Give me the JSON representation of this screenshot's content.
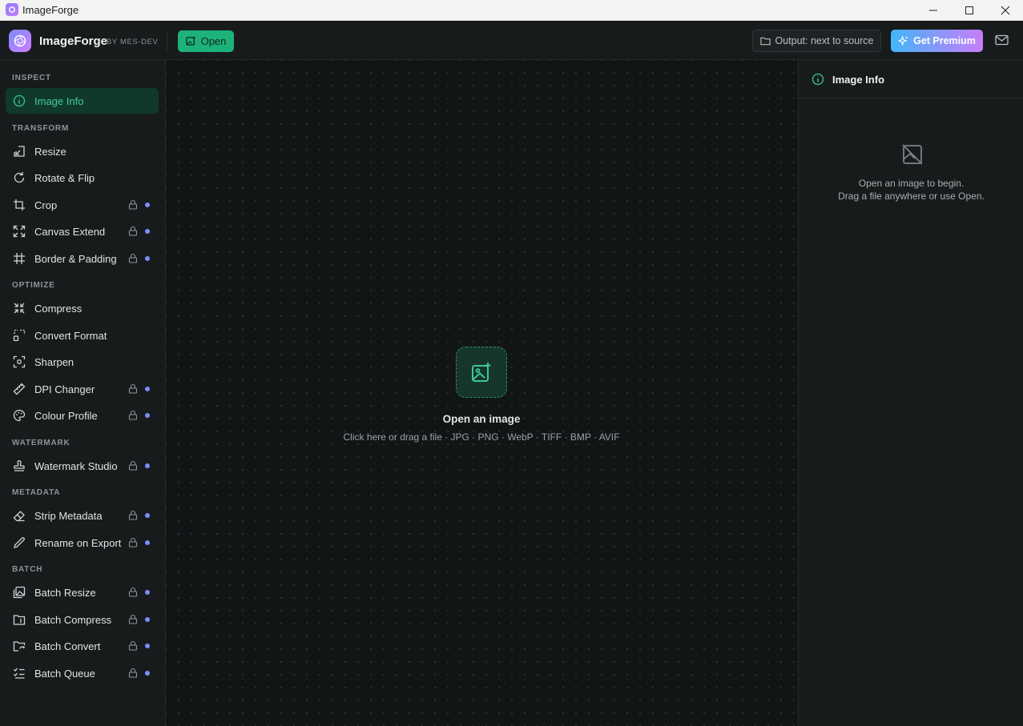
{
  "window": {
    "title": "ImageForge"
  },
  "header": {
    "brand": "ImageForge",
    "by": "BY MES-DEV",
    "open_label": "Open",
    "output_label": "Output: next to source",
    "premium_label": "Get Premium"
  },
  "colors": {
    "accent": "#1db27a",
    "premium_start": "#43b5f7",
    "premium_end": "#c77dfa",
    "locked_dot": "#7f8dfb"
  },
  "sidebar": {
    "sections": [
      {
        "title": "INSPECT"
      },
      {
        "title": "TRANSFORM"
      },
      {
        "title": "OPTIMIZE"
      },
      {
        "title": "WATERMARK"
      },
      {
        "title": "METADATA"
      },
      {
        "title": "BATCH"
      }
    ],
    "items": [
      {
        "label": "Image Info",
        "icon": "info-icon",
        "active": true,
        "locked": false
      },
      {
        "label": "Resize",
        "icon": "resize-icon",
        "locked": false
      },
      {
        "label": "Rotate & Flip",
        "icon": "rotate-icon",
        "locked": false
      },
      {
        "label": "Crop",
        "icon": "crop-icon",
        "locked": true
      },
      {
        "label": "Canvas Extend",
        "icon": "expand-icon",
        "locked": true
      },
      {
        "label": "Border & Padding",
        "icon": "grid-hash-icon",
        "locked": true
      },
      {
        "label": "Compress",
        "icon": "compress-icon",
        "locked": false
      },
      {
        "label": "Convert Format",
        "icon": "convert-icon",
        "locked": false
      },
      {
        "label": "Sharpen",
        "icon": "focus-icon",
        "locked": false
      },
      {
        "label": "DPI Changer",
        "icon": "ruler-icon",
        "locked": true
      },
      {
        "label": "Colour Profile",
        "icon": "palette-icon",
        "locked": true
      },
      {
        "label": "Watermark Studio",
        "icon": "stamp-icon",
        "locked": true
      },
      {
        "label": "Strip Metadata",
        "icon": "eraser-icon",
        "locked": true
      },
      {
        "label": "Rename on Export",
        "icon": "pencil-icon",
        "locked": true
      },
      {
        "label": "Batch Resize",
        "icon": "images-icon",
        "locked": true
      },
      {
        "label": "Batch Compress",
        "icon": "folder-compress-icon",
        "locked": true
      },
      {
        "label": "Batch Convert",
        "icon": "folder-sync-icon",
        "locked": true
      },
      {
        "label": "Batch Queue",
        "icon": "list-check-icon",
        "locked": true
      }
    ]
  },
  "canvas": {
    "title": "Open an image",
    "subtitle": "Click here or drag a file · JPG · PNG · WebP · TIFF · BMP · AVIF"
  },
  "panel": {
    "title": "Image Info",
    "empty_line1": "Open an image to begin.",
    "empty_line2": "Drag a file anywhere or use Open."
  }
}
